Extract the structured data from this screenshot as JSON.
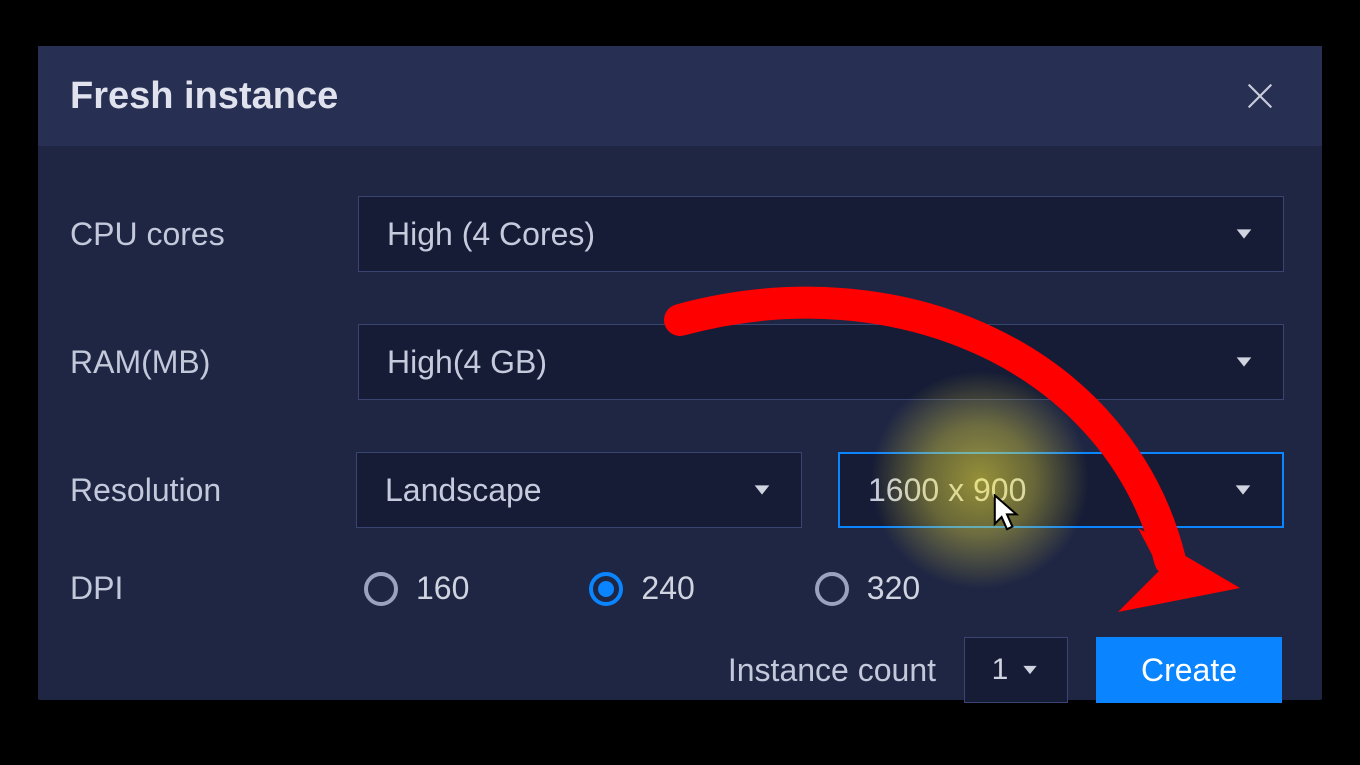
{
  "dialog": {
    "title": "Fresh instance"
  },
  "labels": {
    "cpu": "CPU cores",
    "ram": "RAM(MB)",
    "resolution": "Resolution",
    "dpi": "DPI",
    "instance_count": "Instance count"
  },
  "values": {
    "cpu": "High (4 Cores)",
    "ram": "High(4 GB)",
    "orientation": "Landscape",
    "resolution": "1600 x 900",
    "instance_count": "1"
  },
  "dpi_options": {
    "opt1": "160",
    "opt2": "240",
    "opt3": "320",
    "selected": "240"
  },
  "buttons": {
    "create": "Create"
  }
}
